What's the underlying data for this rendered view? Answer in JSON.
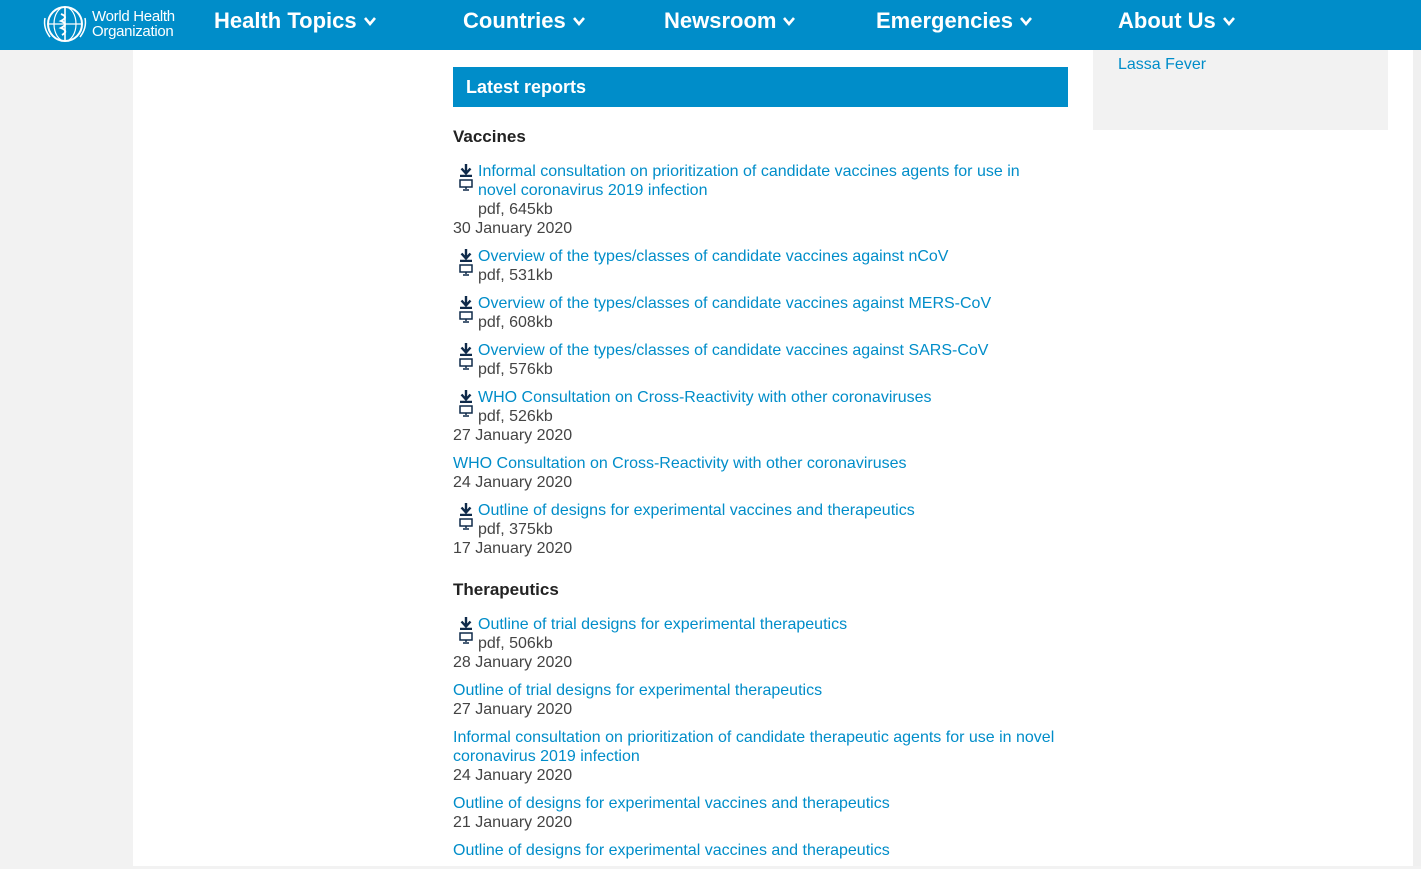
{
  "brand": {
    "logo_line1": "World Health",
    "logo_line2": "Organization",
    "primary_color": "#008dc9"
  },
  "nav": {
    "items": [
      {
        "label": "Health Topics"
      },
      {
        "label": "Countries"
      },
      {
        "label": "Newsroom"
      },
      {
        "label": "Emergencies"
      },
      {
        "label": "About Us"
      }
    ]
  },
  "sidebar": {
    "link_label": "Lassa Fever"
  },
  "main": {
    "section_title": "Latest reports",
    "vaccines": {
      "title": "Vaccines",
      "entries": [
        {
          "link1": "Informal consultation on prioritization of candidate vaccines agents for use in",
          "link2": "novel coronavirus 2019 infection",
          "size": "pdf, 645kb",
          "date": "30 January 2020"
        },
        {
          "link": "Overview of the types/classes of candidate vaccines against nCoV",
          "size": "pdf, 531kb"
        },
        {
          "link": "Overview of the types/classes of candidate vaccines against MERS-CoV",
          "size": "pdf, 608kb"
        },
        {
          "link": "Overview of the types/classes of candidate vaccines against SARS-CoV",
          "size": "pdf, 576kb"
        },
        {
          "link": "WHO Consultation on Cross-Reactivity with other coronaviruses",
          "size": "pdf, 526kb",
          "date": "27 January 2020"
        },
        {
          "link": "WHO Consultation on Cross-Reactivity with other coronaviruses",
          "date": "24 January 2020"
        },
        {
          "link": "Outline of designs for experimental vaccines and therapeutics",
          "size": "pdf, 375kb",
          "date": "17 January 2020"
        }
      ]
    },
    "therapeutics": {
      "title": "Therapeutics",
      "entries": [
        {
          "link": "Outline of trial designs for experimental therapeutics",
          "size": "pdf, 506kb",
          "date": "28 January 2020"
        },
        {
          "link": "Outline of trial designs for experimental therapeutics",
          "date": "27 January 2020"
        },
        {
          "link1": "Informal consultation on prioritization of candidate therapeutic agents for use in novel",
          "link2": "coronavirus 2019 infection",
          "date": "24 January 2020"
        },
        {
          "link": "Outline of designs for experimental vaccines and therapeutics",
          "date": "21 January 2020"
        },
        {
          "link": "Outline of designs for experimental vaccines and therapeutics"
        }
      ]
    }
  },
  "icons": {
    "download": "download-arrow-icon",
    "view": "monitor-icon",
    "chevron": "chevron-down-icon",
    "logo": "who-emblem-icon"
  }
}
